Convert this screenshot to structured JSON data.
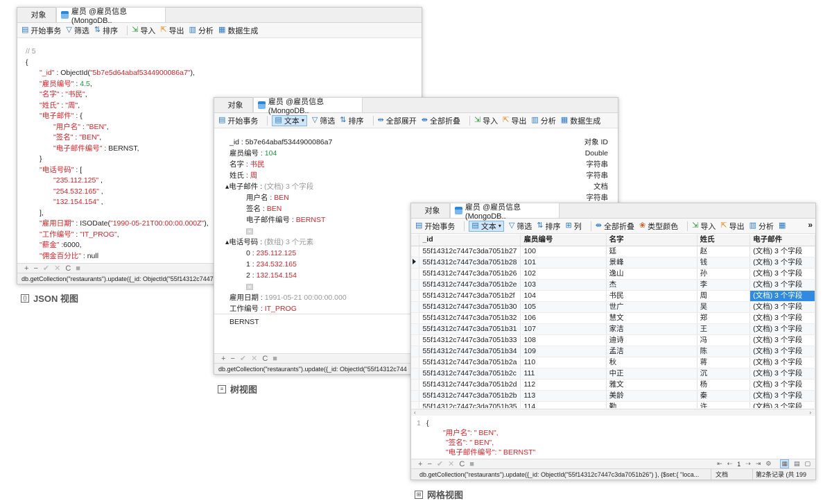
{
  "json_window": {
    "tab_object": "对象",
    "tab_title": "雇员 @雇员信息 (MongoDB..",
    "toolbar": [
      "开始事务",
      "筛选",
      "排序",
      "导入",
      "导出",
      "分析",
      "数据生成"
    ],
    "lines": [
      {
        "indent": 0,
        "parts": [
          [
            "c",
            "// 5"
          ]
        ]
      },
      {
        "indent": 0,
        "parts": [
          [
            "p",
            "{"
          ]
        ]
      },
      {
        "indent": 1,
        "parts": [
          [
            "k",
            "\"_id\""
          ],
          [
            "p",
            " :  ObjectId("
          ],
          [
            "s",
            "\"5b7e5d64abaf5344900086a7\""
          ],
          [
            "p",
            "),"
          ]
        ]
      },
      {
        "indent": 1,
        "parts": [
          [
            "k",
            "\"雇员编号\""
          ],
          [
            "p",
            " :  "
          ],
          [
            "n",
            "4.5"
          ],
          [
            "p",
            ","
          ]
        ]
      },
      {
        "indent": 1,
        "parts": [
          [
            "k",
            "\"名字\""
          ],
          [
            "p",
            " :  "
          ],
          [
            "s",
            "\"书民\""
          ],
          [
            "p",
            ","
          ]
        ]
      },
      {
        "indent": 1,
        "parts": [
          [
            "k",
            "\"姓氏\""
          ],
          [
            "p",
            " :  "
          ],
          [
            "s",
            "\"周\""
          ],
          [
            "p",
            ","
          ]
        ]
      },
      {
        "indent": 1,
        "parts": [
          [
            "k",
            "\"电子邮件\""
          ],
          [
            "p",
            " :  {"
          ]
        ]
      },
      {
        "indent": 2,
        "parts": [
          [
            "k",
            "\"用户名\""
          ],
          [
            "p",
            " :  "
          ],
          [
            "s",
            "\"BEN\""
          ],
          [
            "p",
            ","
          ]
        ]
      },
      {
        "indent": 2,
        "parts": [
          [
            "k",
            "\"签名\""
          ],
          [
            "p",
            " :  "
          ],
          [
            "s",
            "\"BEN\""
          ],
          [
            "p",
            ","
          ]
        ]
      },
      {
        "indent": 2,
        "parts": [
          [
            "k",
            "\"电子邮件编号\""
          ],
          [
            "p",
            " :  BERNST,"
          ]
        ]
      },
      {
        "indent": 1,
        "parts": [
          [
            "p",
            "}"
          ]
        ]
      },
      {
        "indent": 1,
        "parts": [
          [
            "k",
            "\"电话号码\""
          ],
          [
            "p",
            " :  ["
          ]
        ]
      },
      {
        "indent": 2,
        "parts": [
          [
            "s",
            "\"235.112.125\""
          ],
          [
            "p",
            " ,"
          ]
        ]
      },
      {
        "indent": 2,
        "parts": [
          [
            "s",
            "\"254.532.165\""
          ],
          [
            "p",
            " ,"
          ]
        ]
      },
      {
        "indent": 2,
        "parts": [
          [
            "s",
            "\"132.154.154\""
          ],
          [
            "p",
            " ,"
          ]
        ]
      },
      {
        "indent": 1,
        "parts": [
          [
            "p",
            "],"
          ]
        ]
      },
      {
        "indent": 1,
        "parts": [
          [
            "k",
            "\"雇用日期\""
          ],
          [
            "p",
            " :  ISODate("
          ],
          [
            "s",
            "\"1990-05-21T00:00:00.000Z\""
          ],
          [
            "p",
            "),"
          ]
        ]
      },
      {
        "indent": 1,
        "parts": [
          [
            "k",
            "\"工作编号\""
          ],
          [
            "p",
            " :  "
          ],
          [
            "s",
            "\"IT_PROG\""
          ],
          [
            "p",
            ","
          ]
        ]
      },
      {
        "indent": 1,
        "parts": [
          [
            "k",
            "\"薪金\""
          ],
          [
            "p",
            " :6000,"
          ]
        ]
      },
      {
        "indent": 1,
        "parts": [
          [
            "k",
            "\"佣金百分比\""
          ],
          [
            "p",
            " : null"
          ]
        ]
      }
    ],
    "status": "db.getCollection(\"restaurants\").update({_id: ObjectId(\"55f14312c7447",
    "caption": "JSON 视图"
  },
  "tree_window": {
    "tab_object": "对象",
    "tab_title": "雇员 @雇员信息 (MongoDB..",
    "toolbar": [
      "开始事务",
      "文本",
      "筛选",
      "排序",
      "全部展开",
      "全部折叠",
      "导入",
      "导出",
      "分析",
      "数据生成"
    ],
    "rows": [
      {
        "indent": 0,
        "label": "_id : ",
        "value": "5b7e64abaf5344900086a7",
        "vc": "p",
        "type": "对象 ID"
      },
      {
        "indent": 0,
        "label": "雇员编号 : ",
        "value": "104",
        "vc": "n",
        "type": "Double"
      },
      {
        "indent": 0,
        "label": "名字 : ",
        "value": "书民",
        "vc": "s",
        "type": "字符串"
      },
      {
        "indent": 0,
        "label": "姓氏 : ",
        "value": "周",
        "vc": "s",
        "type": "字符串"
      },
      {
        "indent": 0,
        "label": "▴电子邮件 : ",
        "value": "(文档) 3 个字段",
        "vc": "c",
        "type": "文档"
      },
      {
        "indent": 2,
        "label": "用户名 : ",
        "value": "BEN",
        "vc": "s",
        "type": "字符串"
      },
      {
        "indent": 2,
        "label": "签名 : ",
        "value": "BEN",
        "vc": "s",
        "type": ""
      },
      {
        "indent": 2,
        "label": "电子邮件编号 : ",
        "value": "BERNST",
        "vc": "s",
        "type": ""
      },
      {
        "indent": 2,
        "label": "",
        "value": "+",
        "vc": "box",
        "type": ""
      },
      {
        "indent": 0,
        "label": "▴电话号码 : ",
        "value": "(数组) 3 个元素",
        "vc": "c",
        "type": ""
      },
      {
        "indent": 2,
        "label": "0 : ",
        "value": "235.112.125",
        "vc": "s",
        "type": ""
      },
      {
        "indent": 2,
        "label": "1 : ",
        "value": "234.532.165",
        "vc": "s",
        "type": ""
      },
      {
        "indent": 2,
        "label": "2 : ",
        "value": "132.154.154",
        "vc": "s",
        "type": ""
      },
      {
        "indent": 2,
        "label": "",
        "value": "+",
        "vc": "box",
        "type": ""
      },
      {
        "indent": 0,
        "label": "雇用日期 : ",
        "value": "1991-05-21 00:00:00.000",
        "vc": "c",
        "type": ""
      },
      {
        "indent": 0,
        "label": "工作编号 : ",
        "value": "IT_PROG",
        "vc": "s",
        "type": ""
      }
    ],
    "detail_text": "BERNST",
    "status": "db.getCollection(\"restaurants\").update({_id: ObjectId(\"55f14312c744",
    "caption": "树视图"
  },
  "grid_window": {
    "tab_object": "对象",
    "tab_title": "雇员 @雇员信息 (MongoDB..",
    "toolbar": [
      "开始事务",
      "文本",
      "筛选",
      "排序",
      "列",
      "全部折叠",
      "类型颜色",
      "导入",
      "导出",
      "分析"
    ],
    "columns": [
      "_id",
      "雇员编号",
      "名字",
      "姓氏",
      "电子邮件"
    ],
    "rows": [
      [
        "55f14312c7447c3da7051b27",
        "100",
        "廷",
        "赵",
        "(文档) 3 个字段"
      ],
      [
        "55f14312c7447c3da7051b28",
        "101",
        "景峰",
        "钱",
        "(文档) 3 个字段"
      ],
      [
        "55f14312c7447c3da7051b26",
        "102",
        "逸山",
        "孙",
        "(文档) 3 个字段"
      ],
      [
        "55f14312c7447c3da7051b2e",
        "103",
        "杰",
        "李",
        "(文档) 3 个字段"
      ],
      [
        "55f14312c7447c3da7051b2f",
        "104",
        "书民",
        "周",
        "(文档) 3 个字段"
      ],
      [
        "55f14312c7447c3da7051b30",
        "105",
        "世广",
        "吴",
        "(文档) 3 个字段"
      ],
      [
        "55f14312c7447c3da7051b32",
        "106",
        "慧文",
        "郑",
        "(文档) 3 个字段"
      ],
      [
        "55f14312c7447c3da7051b31",
        "107",
        "家洁",
        "王",
        "(文档) 3 个字段"
      ],
      [
        "55f14312c7447c3da7051b33",
        "108",
        "迪诗",
        "冯",
        "(文档) 3 个字段"
      ],
      [
        "55f14312c7447c3da7051b34",
        "109",
        "孟洁",
        "陈",
        "(文档) 3 个字段"
      ],
      [
        "55f14312c7447c3da7051b2a",
        "110",
        "秋",
        "蒋",
        "(文档) 3 个字段"
      ],
      [
        "55f14312c7447c3da7051b2c",
        "111",
        "中正",
        "沉",
        "(文档) 3 个字段"
      ],
      [
        "55f14312c7447c3da7051b2d",
        "112",
        "雅文",
        "杨",
        "(文档) 3 个字段"
      ],
      [
        "55f14312c7447c3da7051b2b",
        "113",
        "美龄",
        "秦",
        "(文档) 3 个字段"
      ],
      [
        "55f14312c7447c3da7051b35",
        "114",
        "勤",
        "许",
        "(文档) 3 个字段"
      ]
    ],
    "editor_lines": [
      {
        "num": "1",
        "text": "{",
        "cls": "p"
      },
      {
        "num": "",
        "text": "\"用户名\": \" BEN\",",
        "cls": "k"
      },
      {
        "num": "",
        "text": "\"签名\": \" BEN\",",
        "cls": "k"
      },
      {
        "num": "",
        "text": "\"电子邮件编号\": \" BERNST\"",
        "cls": "k"
      }
    ],
    "page_number": "1",
    "status_query": "db.getCollection(\"restaurants\").update({_id: ObjectId(\"55f14312c7447c3da7051b26\") }, {$set:{ \"loca...",
    "status_type": "文档",
    "status_record": "第2条记录 (共 199",
    "caption": "网格视图"
  }
}
